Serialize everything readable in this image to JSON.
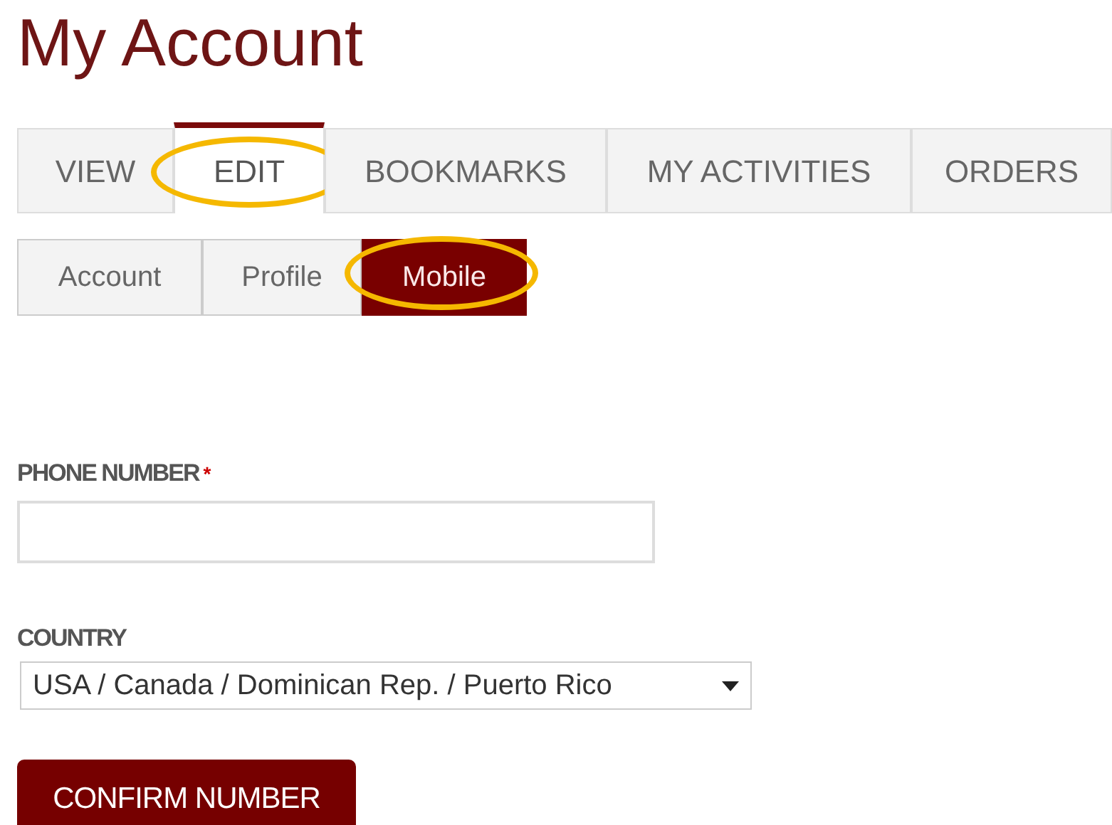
{
  "title": "My Account",
  "tabs": [
    {
      "label": "VIEW",
      "selected": false,
      "highlighted": false
    },
    {
      "label": "EDIT",
      "selected": true,
      "highlighted": true
    },
    {
      "label": "BOOKMARKS",
      "selected": false,
      "highlighted": false
    },
    {
      "label": "MY ACTIVITIES",
      "selected": false,
      "highlighted": false
    },
    {
      "label": "ORDERS",
      "selected": false,
      "highlighted": false
    }
  ],
  "subtabs": [
    {
      "label": "Account",
      "selected": false,
      "highlighted": false
    },
    {
      "label": "Profile",
      "selected": false,
      "highlighted": false
    },
    {
      "label": "Mobile",
      "selected": true,
      "highlighted": true
    }
  ],
  "phone": {
    "label": "PHONE NUMBER",
    "required": true,
    "required_mark": "*"
  },
  "country": {
    "label": "COUNTRY",
    "value": "USA / Canada / Dominican Rep. / Puerto Rico"
  },
  "button": "CONFIRM NUMBER"
}
